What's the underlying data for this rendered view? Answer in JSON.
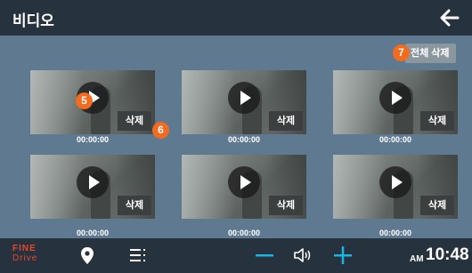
{
  "header": {
    "title": "비디오",
    "back_icon": "arrow-left-icon"
  },
  "toolbar": {
    "delete_all_label": "전체 삭제"
  },
  "badges": {
    "delete_all": "7",
    "play": "5",
    "delete": "6"
  },
  "videos": [
    {
      "time": "00:00:00",
      "delete_label": "삭제"
    },
    {
      "time": "00:00:00",
      "delete_label": "삭제"
    },
    {
      "time": "00:00:00",
      "delete_label": "삭제"
    },
    {
      "time": "00:00:00",
      "delete_label": "삭제"
    },
    {
      "time": "00:00:00",
      "delete_label": "삭제"
    },
    {
      "time": "00:00:00",
      "delete_label": "삭제"
    }
  ],
  "bottom_bar": {
    "logo_line1": "FINE",
    "logo_line2": "Drive",
    "icons": [
      "location-pin-icon",
      "menu-icon",
      "volume-down-icon",
      "speaker-icon",
      "volume-up-icon"
    ],
    "ampm": "AM",
    "time": "10:48"
  },
  "colors": {
    "background": "#5f7a90",
    "bar": "#26323d",
    "accent_cyan": "#19b5e5",
    "badge_orange": "#f26b1f",
    "logo_red": "#e9462b"
  }
}
